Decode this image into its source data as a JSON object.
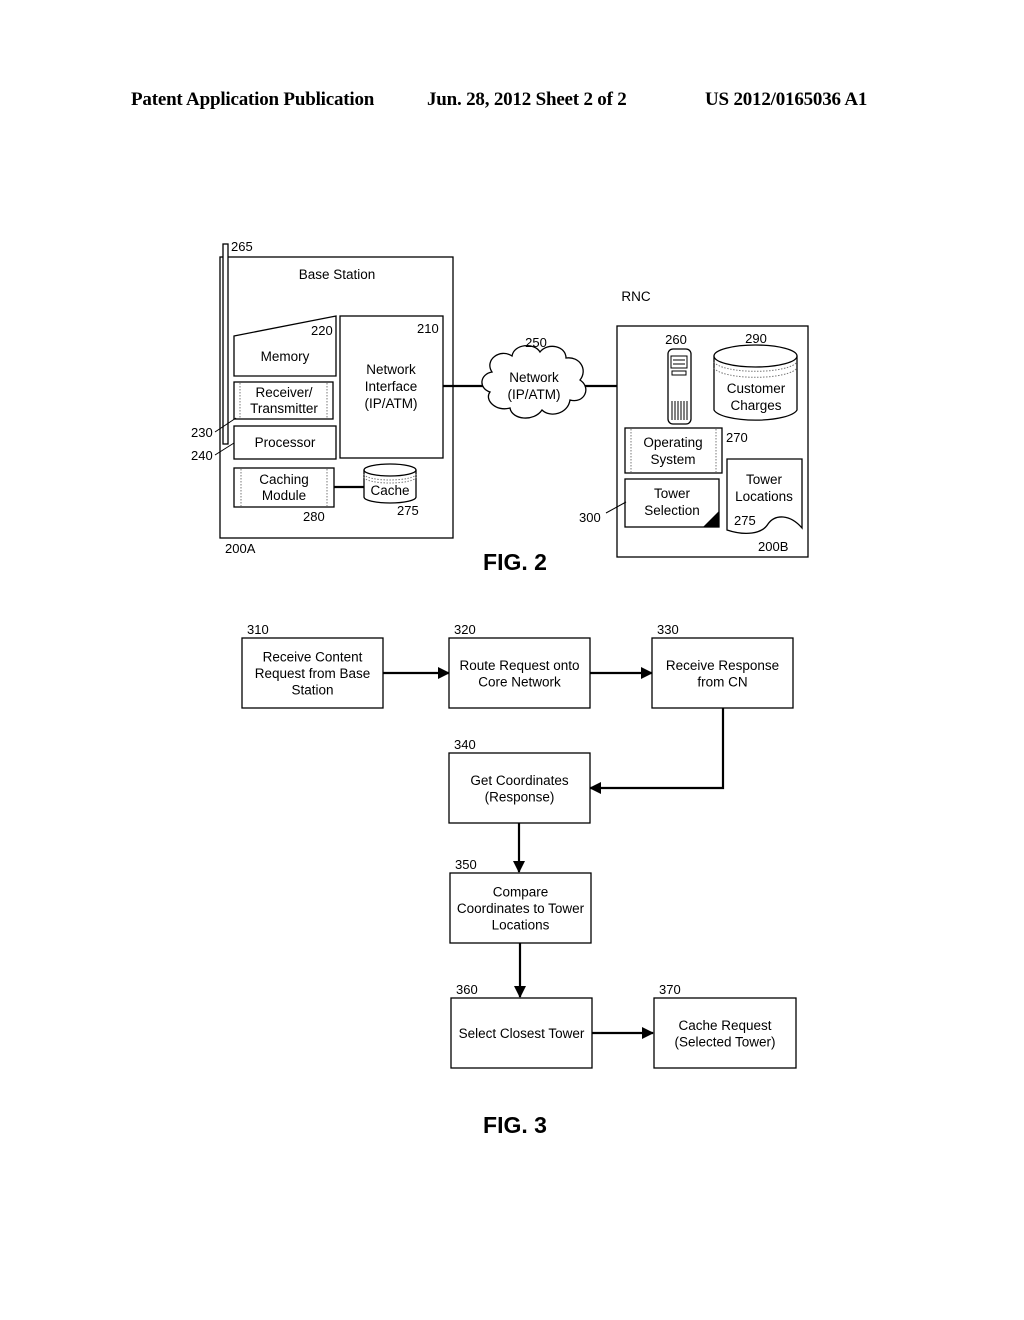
{
  "header": {
    "publication": "Patent Application Publication",
    "date_sheet": "Jun. 28, 2012  Sheet 2 of 2",
    "patent_number": "US 2012/0165036 A1"
  },
  "fig2": {
    "caption": "FIG. 2",
    "base_station": {
      "title": "Base Station",
      "ref": "200A",
      "antenna_ref": "265",
      "memory": {
        "label": "Memory",
        "ref": "220"
      },
      "receiver": {
        "line1": "Receiver/",
        "line2": "Transmitter",
        "ref": "230"
      },
      "processor": {
        "label": "Processor",
        "ref": "240"
      },
      "caching_module": {
        "line1": "Caching",
        "line2": "Module",
        "ref": "280"
      },
      "cache": {
        "label": "Cache",
        "ref": "275"
      },
      "network_interface": {
        "line1": "Network",
        "line2": "Interface",
        "line3": "(IP/ATM)",
        "ref": "210"
      }
    },
    "network": {
      "line1": "Network",
      "line2": "(IP/ATM)",
      "ref": "250"
    },
    "rnc": {
      "title": "RNC",
      "ref": "200B",
      "server_ref": "260",
      "customer_charges": {
        "line1": "Customer",
        "line2": "Charges",
        "ref": "290"
      },
      "operating_system": {
        "line1": "Operating",
        "line2": "System",
        "ref": "270"
      },
      "tower_selection": {
        "line1": "Tower",
        "line2": "Selection",
        "ref": "300"
      },
      "tower_locations": {
        "line1": "Tower",
        "line2": "Locations",
        "ref": "275"
      }
    }
  },
  "fig3": {
    "caption": "FIG. 3",
    "steps": [
      {
        "ref": "310",
        "lines": [
          "Receive Content",
          "Request from Base",
          "Station"
        ]
      },
      {
        "ref": "320",
        "lines": [
          "Route Request onto",
          "Core Network"
        ]
      },
      {
        "ref": "330",
        "lines": [
          "Receive Response",
          "from CN"
        ]
      },
      {
        "ref": "340",
        "lines": [
          "Get Coordinates",
          "(Response)"
        ]
      },
      {
        "ref": "350",
        "lines": [
          "Compare",
          "Coordinates to Tower",
          "Locations"
        ]
      },
      {
        "ref": "360",
        "lines": [
          "Select Closest Tower"
        ]
      },
      {
        "ref": "370",
        "lines": [
          "Cache Request",
          "(Selected Tower)"
        ]
      }
    ]
  }
}
